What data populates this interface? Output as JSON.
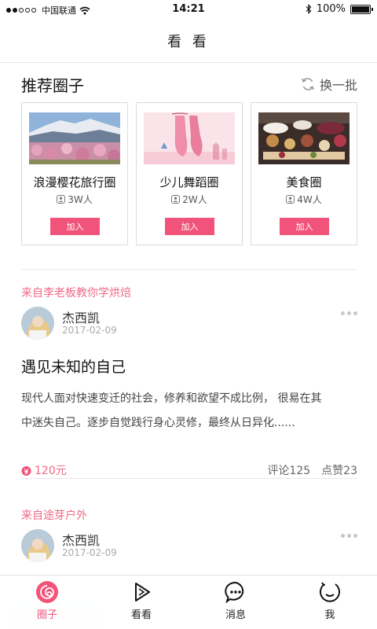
{
  "status": {
    "carrier": "中国联通",
    "time": "14:21",
    "battery": "100%"
  },
  "nav": {
    "title": "看 看"
  },
  "recommend": {
    "title": "推荐圈子",
    "refresh_label": "换一批",
    "join_label": "加入",
    "cards": [
      {
        "name": "浪漫樱花旅行圈",
        "members": "3W人"
      },
      {
        "name": "少儿舞蹈圈",
        "members": "2W人"
      },
      {
        "name": "美食圈",
        "members": "4W人"
      }
    ]
  },
  "posts": [
    {
      "source": "来自李老板教你学烘焙",
      "author": "杰西凯",
      "date": "2017-02-09",
      "title": "遇见未知的自己",
      "body_line1": "现代人面对快速变迁的社会，修养和欲望不成比例， 很易在其",
      "body_line2": "中迷失自己。逐步自觉践行身心灵修，最终从日异化......",
      "reward": "120元",
      "comments": "评论125",
      "likes": "点赞23"
    },
    {
      "source": "来自途芽户外",
      "author": "杰西凯",
      "date": "2017-02-09"
    }
  ],
  "tabs": [
    {
      "label": "圈子"
    },
    {
      "label": "看看"
    },
    {
      "label": "消息"
    },
    {
      "label": "我"
    }
  ],
  "colors": {
    "accent": "#f2537a",
    "source_text": "#f06a86"
  }
}
